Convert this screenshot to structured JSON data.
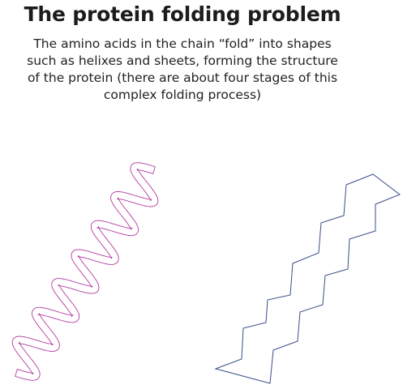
{
  "title": "The protein folding problem",
  "description": "The amino acids in the chain “fold” into shapes such as helixes and sheets, forming the structure of the protein (there are about four stages of this complex folding process)",
  "colors": {
    "helix_stroke": "#b23aa0",
    "sheet_stroke": "#3a4e8a",
    "text": "#1c1c1c"
  }
}
